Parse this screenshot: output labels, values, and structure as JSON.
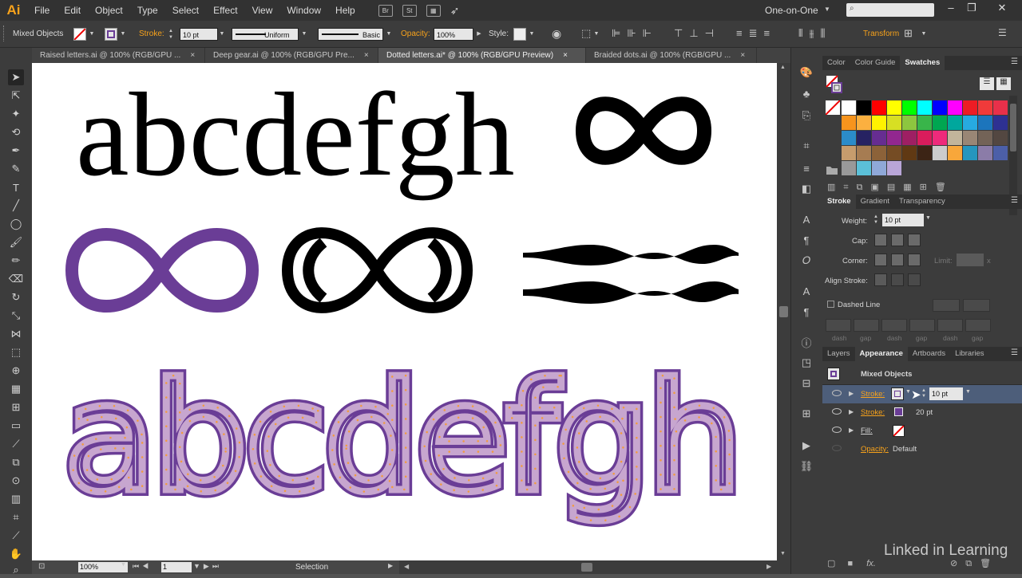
{
  "app": {
    "logo": "Ai"
  },
  "menu": [
    "File",
    "Edit",
    "Object",
    "Type",
    "Select",
    "Effect",
    "View",
    "Window",
    "Help"
  ],
  "menubar_icons": {
    "bridge": "Br",
    "stock": "St"
  },
  "workspace": "One-on-One",
  "control": {
    "selection_label": "Mixed Objects",
    "stroke_label": "Stroke:",
    "stroke_weight": "10 pt",
    "profile_label": "Uniform",
    "brush_label": "Basic",
    "opacity_label": "Opacity:",
    "opacity_value": "100%",
    "style_label": "Style:",
    "transform_label": "Transform"
  },
  "tabs": [
    {
      "label": "Raised letters.ai @ 100% (RGB/GPU ...",
      "active": false
    },
    {
      "label": "Deep gear.ai @ 100% (RGB/GPU Pre...",
      "active": false
    },
    {
      "label": "Dotted letters.ai* @ 100% (RGB/GPU Preview)",
      "active": true
    },
    {
      "label": "Braided dots.ai @ 100% (RGB/GPU ...",
      "active": false
    }
  ],
  "tab_close": "×",
  "artwork": {
    "line1": "abcdefgh",
    "infinity": "∞",
    "line3": "abcdefgh",
    "purple": "#6a3d96",
    "lilac": "#c7a6cf",
    "dot_orange": "#f29a3e"
  },
  "status": {
    "zoom": "100%",
    "artboard": "1",
    "tool": "Selection"
  },
  "swatch_panel": {
    "tabs": [
      "Color",
      "Color Guide",
      "Swatches"
    ],
    "active_tab": "Swatches",
    "rows": [
      [
        "#ffffff",
        "#000000",
        "#ff0000",
        "#ffff00",
        "#00ff00",
        "#00ffff",
        "#0000ff",
        "#ff00ff",
        "#ed1c24",
        "#f03a3a",
        "#e8304a"
      ],
      [
        "#f7941d",
        "#fbb040",
        "#fff200",
        "#d7df23",
        "#8dc63f",
        "#39b54a",
        "#00a651",
        "#00a79d",
        "#27aae1",
        "#1c75bc",
        "#2e3192"
      ],
      [
        "#2b8bc9",
        "#262262",
        "#662d91",
        "#92278f",
        "#9e1f63",
        "#da1c5c",
        "#ee2a7b",
        "#c2b59b",
        "#998675",
        "#736357",
        "#534741"
      ],
      [
        "#c69c6d",
        "#a67c52",
        "#8c6239",
        "#754c24",
        "#603913",
        "#3c2415",
        "#cccccc",
        "#f8a73a",
        "#2596be",
        "#8b7ca8",
        "#4c5fa8"
      ],
      [
        "#999999",
        "#5bc0d8",
        "#8fa8d8",
        "#b9a6d8"
      ]
    ]
  },
  "stroke_panel": {
    "tabs": [
      "Stroke",
      "Gradient",
      "Transparency"
    ],
    "weight_label": "Weight:",
    "weight_value": "10 pt",
    "cap_label": "Cap:",
    "corner_label": "Corner:",
    "limit_label": "Limit:",
    "limit_x": "x",
    "align_label": "Align Stroke:",
    "dashed_label": "Dashed Line",
    "dash_labels": [
      "dash",
      "gap",
      "dash",
      "gap",
      "dash",
      "gap"
    ]
  },
  "appearance_panel": {
    "tabs": [
      "Layers",
      "Appearance",
      "Artboards",
      "Libraries"
    ],
    "active_tab": "Appearance",
    "title": "Mixed Objects",
    "rows": [
      {
        "label": "Stroke:",
        "value": "10 pt"
      },
      {
        "label": "Stroke:",
        "value": "20 pt"
      },
      {
        "label": "Fill:",
        "value": ""
      },
      {
        "label": "Opacity:",
        "value": "Default"
      }
    ],
    "fx_label": "fx."
  },
  "watermark": "Linked in Learning"
}
